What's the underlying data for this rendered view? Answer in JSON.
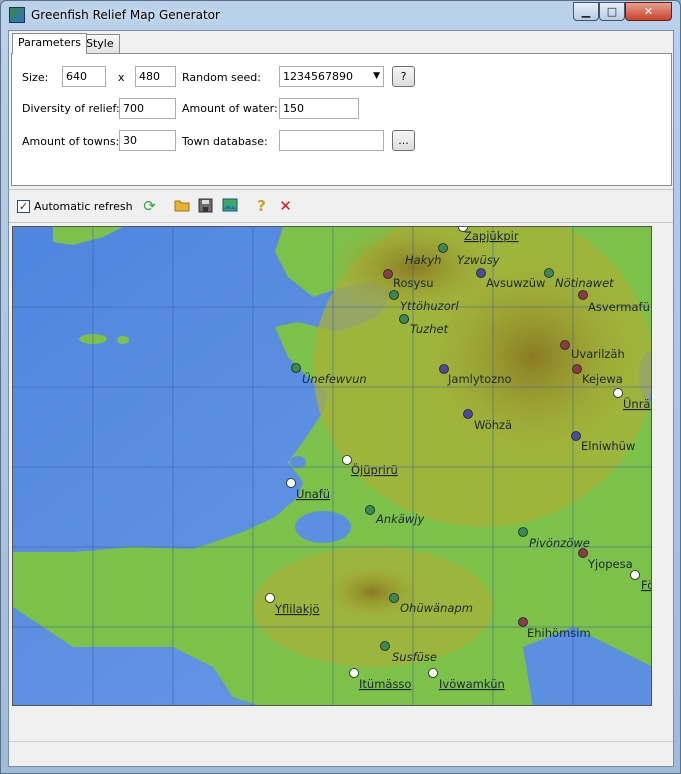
{
  "window": {
    "title": "Greenfish Relief Map Generator",
    "minimize_glyph": "▁",
    "maximize_glyph": "□",
    "close_glyph": "✕"
  },
  "tabs": [
    {
      "label": "Parameters",
      "active": true
    },
    {
      "label": "Style",
      "active": false
    }
  ],
  "params": {
    "size_label": "Size:",
    "size_width": "640",
    "size_x": "x",
    "size_height": "480",
    "seed_label": "Random seed:",
    "seed_value": "1234567890",
    "seed_help": "?",
    "diversity_label": "Diversity of relief:",
    "diversity_value": "700",
    "water_label": "Amount of water:",
    "water_value": "150",
    "towns_label": "Amount of towns:",
    "towns_value": "30",
    "town_db_label": "Town database:",
    "town_db_value": "",
    "browse_label": "..."
  },
  "toolbar": {
    "auto_refresh_label": "Automatic refresh",
    "auto_refresh_checked": true,
    "icons": [
      "refresh-icon",
      "open-folder-icon",
      "save-icon",
      "export-image-icon",
      "help-icon",
      "close-icon"
    ]
  },
  "map": {
    "colors": {
      "water": "#5b8fe0",
      "lowland": "#7cc24a",
      "upland": "#a9b038",
      "hill": "#8a7a22",
      "grid": "#3a5fa8"
    },
    "towns": [
      {
        "name": "Zapjükpir",
        "style": "underline",
        "dot": "white"
      },
      {
        "name": "Hakyh",
        "style": "italic",
        "dot": "red"
      },
      {
        "name": "Yzwüsy",
        "style": "italic",
        "dot": "green"
      },
      {
        "name": "Rosysu",
        "style": "plain",
        "dot": "green"
      },
      {
        "name": "Avsuwzüw",
        "style": "plain",
        "dot": "purple"
      },
      {
        "name": "Nötinawet",
        "style": "italic",
        "dot": "green"
      },
      {
        "name": "Asvermafü",
        "style": "plain",
        "dot": "red"
      },
      {
        "name": "Yttöhuzorl",
        "style": "italic",
        "dot": "green"
      },
      {
        "name": "Tuzhet",
        "style": "italic",
        "dot": "green"
      },
      {
        "name": "Uvarilzäh",
        "style": "plain",
        "dot": "red"
      },
      {
        "name": "Ünefewvun",
        "style": "italic",
        "dot": "green"
      },
      {
        "name": "Jamlytozno",
        "style": "plain",
        "dot": "purple"
      },
      {
        "name": "Kejewa",
        "style": "plain",
        "dot": "red"
      },
      {
        "name": "Ünräv",
        "style": "underline",
        "dot": "white"
      },
      {
        "name": "Wöhzä",
        "style": "plain",
        "dot": "purple"
      },
      {
        "name": "Elniwhüw",
        "style": "plain",
        "dot": "purple"
      },
      {
        "name": "Öjüprirü",
        "style": "underline",
        "dot": "white"
      },
      {
        "name": "Unafü",
        "style": "underline",
        "dot": "white"
      },
      {
        "name": "Ankäwjy",
        "style": "italic",
        "dot": "green"
      },
      {
        "name": "Pivönzöwe",
        "style": "italic",
        "dot": "green"
      },
      {
        "name": "Yjopesa",
        "style": "plain",
        "dot": "red"
      },
      {
        "name": "Fö",
        "style": "underline",
        "dot": "white"
      },
      {
        "name": "Yflilakjö",
        "style": "underline",
        "dot": "white"
      },
      {
        "name": "Ohüwänapm",
        "style": "italic",
        "dot": "green"
      },
      {
        "name": "Ehihömsim",
        "style": "plain",
        "dot": "red"
      },
      {
        "name": "Susfüse",
        "style": "italic",
        "dot": "green"
      },
      {
        "name": "Itümässo",
        "style": "underline",
        "dot": "white"
      },
      {
        "name": "Ivöwamkün",
        "style": "underline",
        "dot": "white"
      }
    ]
  }
}
